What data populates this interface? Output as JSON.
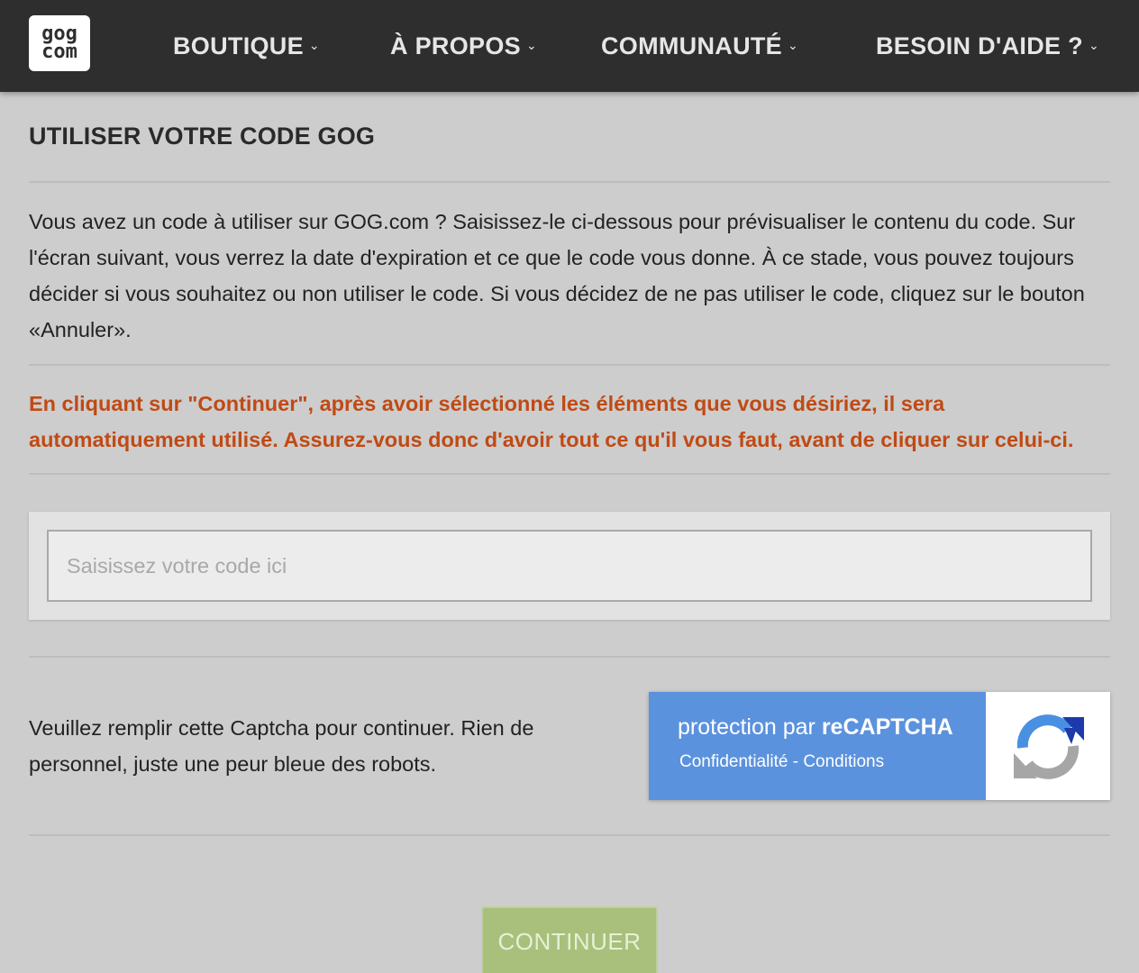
{
  "header": {
    "logo": {
      "line1": "gog",
      "line2": "com"
    },
    "nav": [
      {
        "label": "BOUTIQUE",
        "icon": "chevron-down-icon"
      },
      {
        "label": "À PROPOS",
        "icon": "chevron-down-icon"
      },
      {
        "label": "COMMUNAUTÉ",
        "icon": "chevron-down-icon"
      },
      {
        "label": "BESOIN D'AIDE ?",
        "icon": "chevron-down-icon"
      }
    ]
  },
  "main": {
    "title": "UTILISER VOTRE CODE GOG",
    "intro": "Vous avez un code à utiliser sur GOG.com ? Saisissez-le ci-dessous pour prévisualiser le contenu du code. Sur l'écran suivant, vous verrez la date d'expiration et ce que le code vous donne. À ce stade, vous pouvez toujours décider si vous souhaitez ou non utiliser le code. Si vous décidez de ne pas utiliser le code, cliquez sur le bouton «Annuler».",
    "warning": "En cliquant sur \"Continuer\", après avoir sélectionné les éléments que vous désiriez, il sera automatiquement utilisé. Assurez-vous donc d'avoir tout ce qu'il vous faut, avant de cliquer sur celui-ci.",
    "code_input": {
      "value": "",
      "placeholder": "Saisissez votre code ici"
    },
    "captcha_text": "Veuillez remplir cette Captcha pour continuer. Rien de personnel, juste une peur bleue des robots.",
    "recaptcha": {
      "prefix": "protection par ",
      "brand": "reCAPTCHA",
      "privacy": "Confidentialité",
      "separator": " - ",
      "terms": "Conditions"
    },
    "continue_label": "CONTINUER"
  },
  "colors": {
    "topbar": "#2e2e2e",
    "background": "#cdcdcd",
    "warning": "#c04a14",
    "recaptcha_blue": "#5b92de",
    "continue_button": "#a8c07b"
  }
}
